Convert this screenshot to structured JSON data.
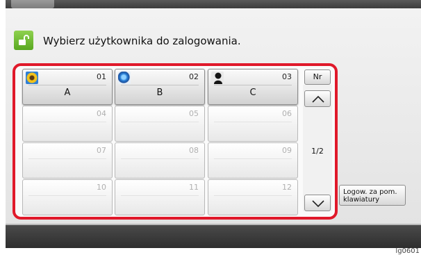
{
  "header": {
    "title": "Wybierz użytkownika do zalogowania.",
    "icon": "unlock-icon",
    "icon_color": "#6cbf2e"
  },
  "users": [
    {
      "num": "01",
      "name": "A",
      "avatar": "sunflower-avatar",
      "active": true
    },
    {
      "num": "02",
      "name": "B",
      "avatar": "globe-avatar",
      "active": true
    },
    {
      "num": "03",
      "name": "C",
      "avatar": "silhouette-avatar",
      "active": true
    },
    {
      "num": "04",
      "name": "",
      "active": false
    },
    {
      "num": "05",
      "name": "",
      "active": false
    },
    {
      "num": "06",
      "name": "",
      "active": false
    },
    {
      "num": "07",
      "name": "",
      "active": false
    },
    {
      "num": "08",
      "name": "",
      "active": false
    },
    {
      "num": "09",
      "name": "",
      "active": false
    },
    {
      "num": "10",
      "name": "",
      "active": false
    },
    {
      "num": "11",
      "name": "",
      "active": false
    },
    {
      "num": "12",
      "name": "",
      "active": false
    }
  ],
  "sort_button": {
    "label": "Nr"
  },
  "pagination": {
    "indicator": "1/2"
  },
  "keyboard_login_button": {
    "label_line1": "Logow. za pom.",
    "label_line2": "klawiatury"
  },
  "figure_id": "lg0601",
  "colors": {
    "highlight_frame": "#e0192a"
  }
}
